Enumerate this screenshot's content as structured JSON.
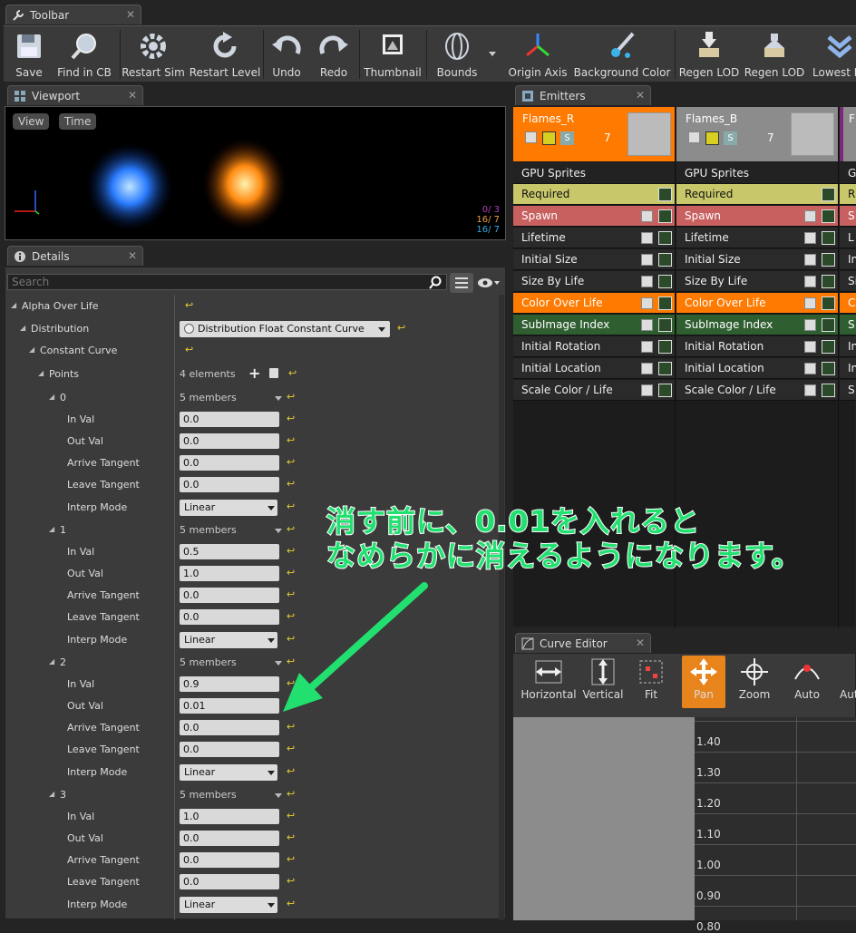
{
  "toolbar_tab": "Toolbar",
  "toolbar": [
    "Save",
    "Find in CB",
    "Restart Sim",
    "Restart Level",
    "Undo",
    "Redo",
    "Thumbnail",
    "Bounds",
    "Origin Axis",
    "Background Color",
    "Regen LOD",
    "Regen LOD",
    "Lowest L"
  ],
  "viewport": {
    "tab": "Viewport",
    "view": "View",
    "time": "Time",
    "stats": [
      "0/ 3",
      "16/ 7",
      "16/ 7"
    ]
  },
  "details": {
    "tab": "Details",
    "search_placeholder": "Search",
    "alpha": "Alpha Over Life",
    "distribution": "Distribution",
    "distribution_value": "Distribution Float Constant Curve",
    "constant_curve": "Constant Curve",
    "points": "Points",
    "points_count": "4 elements",
    "point_labels": {
      "in": "In Val",
      "out": "Out Val",
      "arrive": "Arrive Tangent",
      "leave": "Leave Tangent",
      "interp": "Interp Mode"
    },
    "members": "5 members",
    "pts": [
      {
        "idx": "0",
        "in": "0.0",
        "out": "0.0",
        "arrive": "0.0",
        "leave": "0.0",
        "interp": "Linear"
      },
      {
        "idx": "1",
        "in": "0.5",
        "out": "1.0",
        "arrive": "0.0",
        "leave": "0.0",
        "interp": "Linear"
      },
      {
        "idx": "2",
        "in": "0.9",
        "out": "0.01",
        "arrive": "0.0",
        "leave": "0.0",
        "interp": "Linear"
      },
      {
        "idx": "3",
        "in": "1.0",
        "out": "0.0",
        "arrive": "0.0",
        "leave": "0.0",
        "interp": "Linear"
      }
    ]
  },
  "emitters": {
    "tab": "Emitters",
    "cols": [
      {
        "name": "Flames_R",
        "count": "7",
        "type": "GPU Sprites"
      },
      {
        "name": "Flames_B",
        "count": "7",
        "type": "GPU Sprites"
      },
      {
        "name": "F",
        "count": "",
        "type": "G"
      }
    ],
    "modules": [
      "Required",
      "Spawn",
      "Lifetime",
      "Initial Size",
      "Size By Life",
      "Color Over Life",
      "SubImage Index",
      "Initial Rotation",
      "Initial Location",
      "Scale Color / Life"
    ],
    "modules_short": [
      "R",
      "S",
      "L",
      "In",
      "Si",
      "C",
      "S",
      "In",
      "In",
      "S"
    ]
  },
  "curve_editor": {
    "tab": "Curve Editor",
    "buttons": [
      "Horizontal",
      "Vertical",
      "Fit",
      "Pan",
      "Zoom",
      "Auto",
      "Aut"
    ],
    "yticks": [
      "1.40",
      "1.30",
      "1.20",
      "1.10",
      "1.00",
      "0.90",
      "0.80"
    ]
  },
  "annotation": {
    "line1": "消す前に、0.01を入れると",
    "line2": "なめらかに消えるようになります。"
  }
}
